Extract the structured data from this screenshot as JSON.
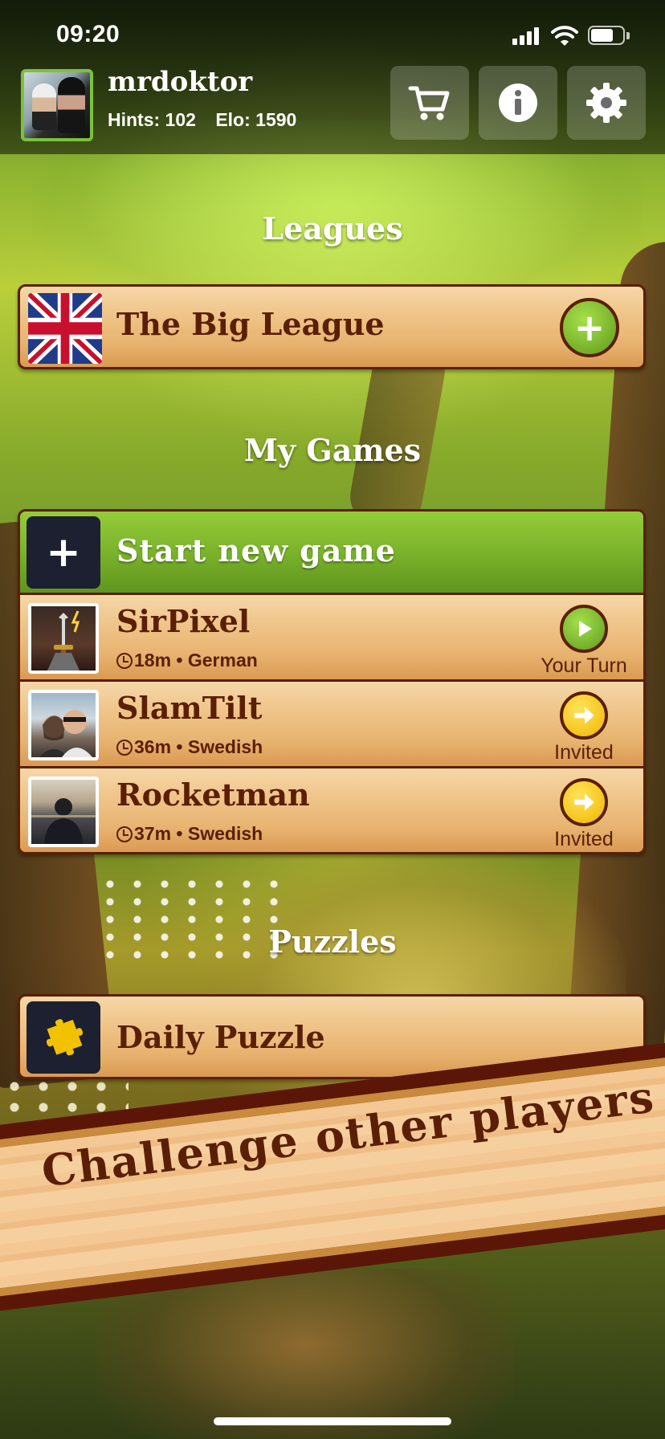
{
  "status_bar": {
    "time": "09:20",
    "battery_level": 0.7
  },
  "header": {
    "username": "mrdoktor",
    "hints_label": "Hints: 102",
    "elo_label": "Elo: 1590",
    "buttons": [
      {
        "name": "shop",
        "icon": "cart-icon"
      },
      {
        "name": "info",
        "icon": "info-icon"
      },
      {
        "name": "settings",
        "icon": "gear-icon"
      }
    ]
  },
  "leagues": {
    "title": "Leagues",
    "items": [
      {
        "name": "The Big League",
        "flag": "uk-flag-icon",
        "action_icon": "plus-icon"
      }
    ]
  },
  "my_games": {
    "title": "My Games",
    "new_game_label": "Start new game",
    "games": [
      {
        "name": "SirPixel",
        "meta": "18m • German",
        "status": "Your Turn",
        "status_icon": "play-icon"
      },
      {
        "name": "SlamTilt",
        "meta": "36m • Swedish",
        "status": "Invited",
        "status_icon": "arrow-right-icon"
      },
      {
        "name": "Rocketman",
        "meta": "37m • Swedish",
        "status": "Invited",
        "status_icon": "arrow-right-icon"
      }
    ]
  },
  "puzzles": {
    "title": "Puzzles",
    "items": [
      {
        "name": "Daily Puzzle",
        "icon": "puzzle-piece-icon"
      }
    ]
  },
  "banner": {
    "text": "Challenge other players"
  },
  "colors": {
    "accent_green": "#78b02a",
    "wood_text": "#5a1f06",
    "avatar_border": "#7cc13a",
    "invite_yellow": "#f0b600"
  }
}
